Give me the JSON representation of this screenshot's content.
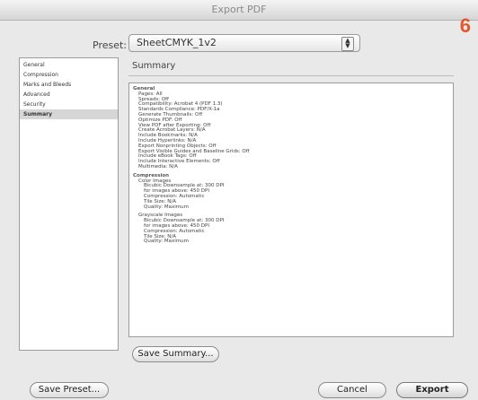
{
  "window": {
    "title": "Export PDF"
  },
  "step_number": "6",
  "preset": {
    "label": "Preset:",
    "value": "SheetCMYK_1v2"
  },
  "sidebar": {
    "items": [
      {
        "label": "General",
        "selected": false
      },
      {
        "label": "Compression",
        "selected": false
      },
      {
        "label": "Marks and Bleeds",
        "selected": false
      },
      {
        "label": "Advanced",
        "selected": false
      },
      {
        "label": "Security",
        "selected": false
      },
      {
        "label": "Summary",
        "selected": true
      }
    ]
  },
  "summary": {
    "title": "Summary",
    "lines": [
      {
        "text": "General",
        "level": 0
      },
      {
        "text": "Pages: All",
        "level": 1
      },
      {
        "text": "Spreads: Off",
        "level": 1
      },
      {
        "text": "Compatibility: Acrobat 4 (PDF 1.3)",
        "level": 1
      },
      {
        "text": "Standards Compliance: PDF/X-1a",
        "level": 1
      },
      {
        "text": "Generate Thumbnails: Off",
        "level": 1
      },
      {
        "text": "Optimize PDF: Off",
        "level": 1
      },
      {
        "text": "View PDF after Exporting: Off",
        "level": 1
      },
      {
        "text": "Create Acrobat Layers: N/A",
        "level": 1
      },
      {
        "text": "Include Bookmarks: N/A",
        "level": 1
      },
      {
        "text": "Include Hyperlinks: N/A",
        "level": 1
      },
      {
        "text": "Export Nonprinting Objects: Off",
        "level": 1
      },
      {
        "text": "Export Visible Guides and Baseline Grids: Off",
        "level": 1
      },
      {
        "text": "Include eBook Tags: Off",
        "level": 1
      },
      {
        "text": "Include Interactive Elements: Off",
        "level": 1
      },
      {
        "text": "Multimedia: N/A",
        "level": 1
      },
      {
        "text": "",
        "level": -1
      },
      {
        "text": "Compression",
        "level": 0
      },
      {
        "text": "Color Images",
        "level": 1
      },
      {
        "text": "Bicubic Downsample at: 300 DPI",
        "level": 2
      },
      {
        "text": "for images above: 450 DPI",
        "level": 2
      },
      {
        "text": "Compression: Automatic",
        "level": 2
      },
      {
        "text": "Tile Size: N/A",
        "level": 2
      },
      {
        "text": "Quality: Maximum",
        "level": 2
      },
      {
        "text": "",
        "level": -1
      },
      {
        "text": "Grayscale Images",
        "level": 1
      },
      {
        "text": "Bicubic Downsample at: 300 DPI",
        "level": 2
      },
      {
        "text": "for images above: 450 DPI",
        "level": 2
      },
      {
        "text": "Compression: Automatic",
        "level": 2
      },
      {
        "text": "Tile Size: N/A",
        "level": 2
      },
      {
        "text": "Quality: Maximum",
        "level": 2
      }
    ]
  },
  "buttons": {
    "save_summary": "Save Summary...",
    "save_preset": "Save Preset...",
    "cancel": "Cancel",
    "export": "Export"
  },
  "colors": {
    "step_number": "#e2582d"
  }
}
